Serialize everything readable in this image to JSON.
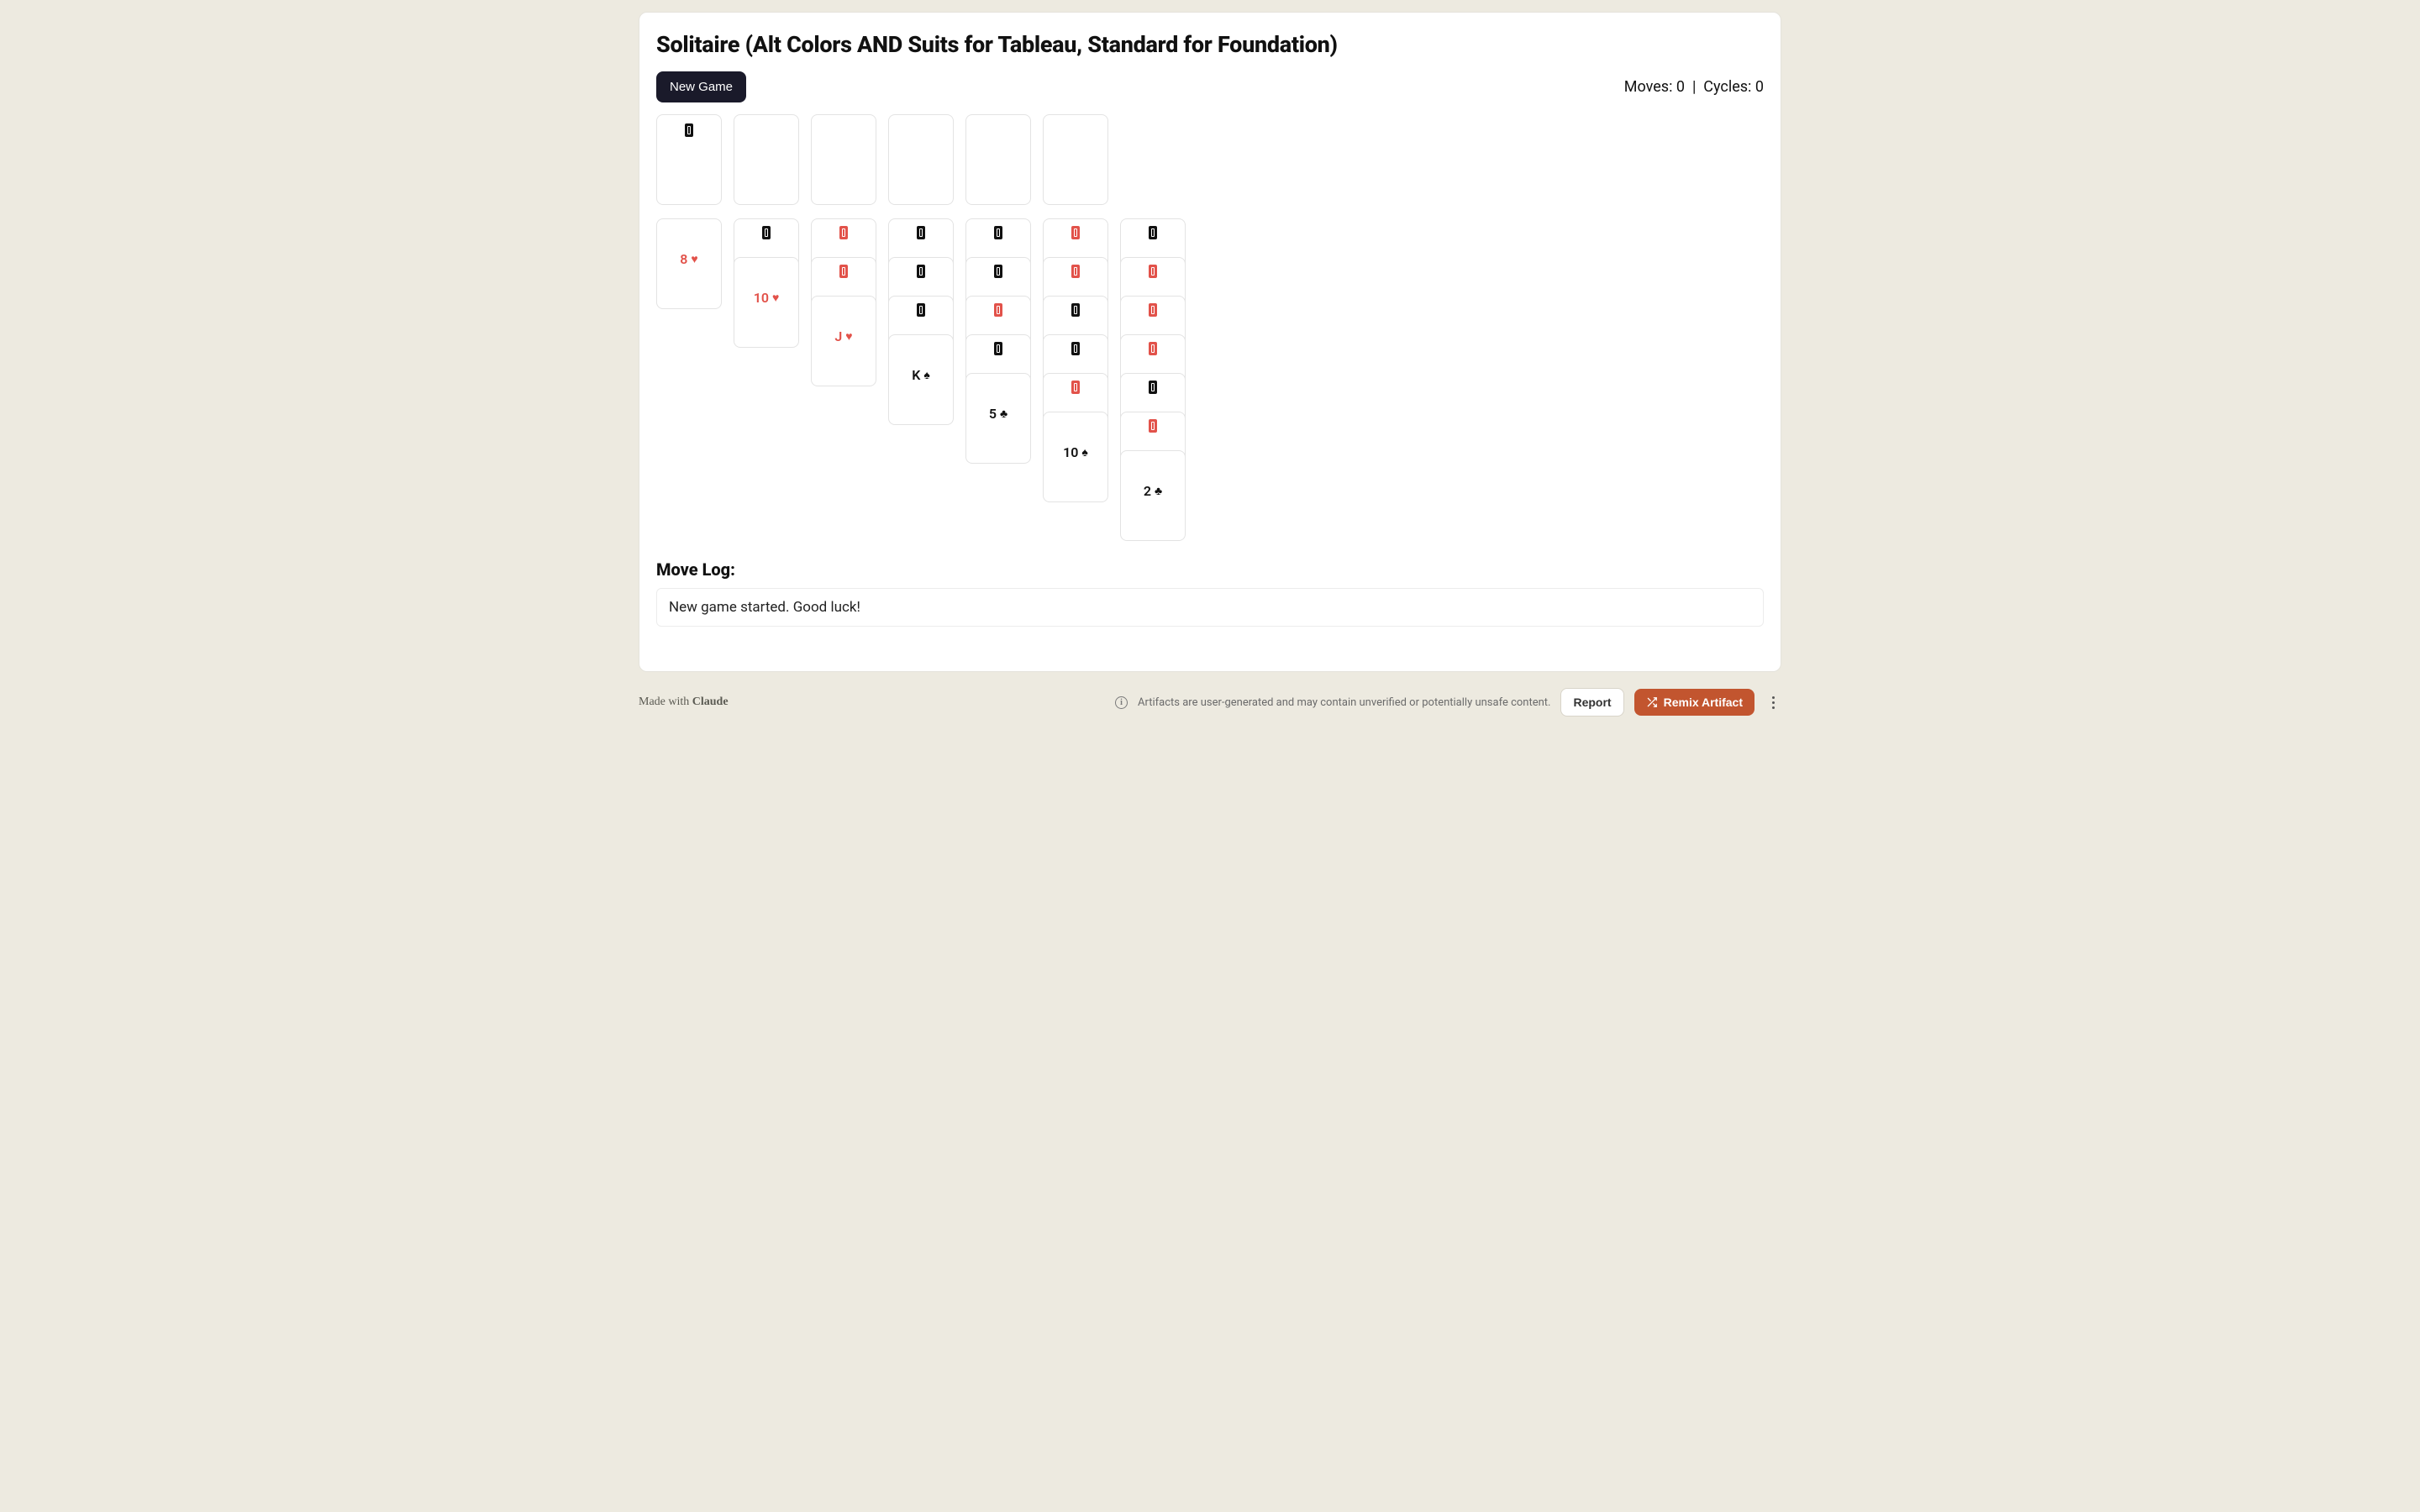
{
  "title": "Solitaire (Alt Colors AND Suits for Tableau, Standard for Foundation)",
  "toolbar": {
    "new_game_label": "New Game"
  },
  "counters": {
    "moves_label": "Moves",
    "moves_value": 0,
    "cycles_label": "Cycles",
    "cycles_value": 0
  },
  "stock": {
    "back_color": "black"
  },
  "waste": null,
  "foundations": [
    null,
    null,
    null,
    null
  ],
  "tableau": [
    {
      "hidden": [],
      "face_up": {
        "rank": "8",
        "suit": "heart",
        "color": "red"
      }
    },
    {
      "hidden": [
        "black"
      ],
      "face_up": {
        "rank": "10",
        "suit": "heart",
        "color": "red"
      }
    },
    {
      "hidden": [
        "red",
        "red"
      ],
      "face_up": {
        "rank": "J",
        "suit": "heart",
        "color": "red"
      }
    },
    {
      "hidden": [
        "black",
        "black",
        "black"
      ],
      "face_up": {
        "rank": "K",
        "suit": "spade",
        "color": "black"
      }
    },
    {
      "hidden": [
        "black",
        "black",
        "red",
        "black"
      ],
      "face_up": {
        "rank": "5",
        "suit": "club",
        "color": "black"
      }
    },
    {
      "hidden": [
        "red",
        "red",
        "black",
        "black",
        "red"
      ],
      "face_up": {
        "rank": "10",
        "suit": "spade",
        "color": "black"
      }
    },
    {
      "hidden": [
        "black",
        "red",
        "red",
        "red",
        "black",
        "red"
      ],
      "face_up": {
        "rank": "2",
        "suit": "club",
        "color": "black"
      }
    }
  ],
  "move_log": {
    "title": "Move Log:",
    "entries": [
      "New game started. Good luck!"
    ]
  },
  "footer": {
    "made_with_prefix": "Made with ",
    "made_with_brand": "Claude",
    "warning": "Artifacts are user-generated and may contain unverified or potentially unsafe content.",
    "report_label": "Report",
    "remix_label": "Remix Artifact"
  },
  "suit_glyphs": {
    "heart": "♥",
    "spade": "♠",
    "club": "♣",
    "diamond": "♦"
  }
}
